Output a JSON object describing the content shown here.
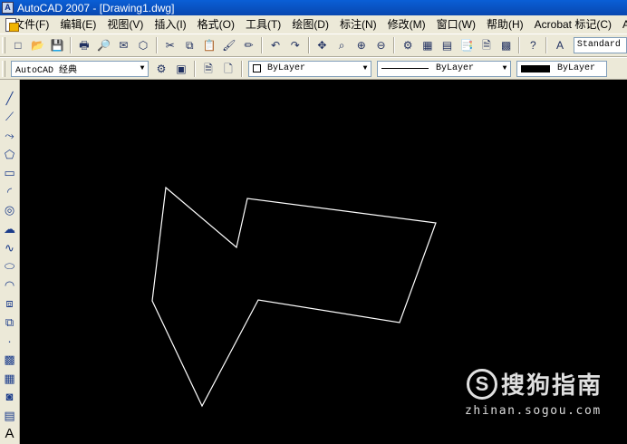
{
  "window": {
    "title": "AutoCAD 2007 - [Drawing1.dwg]",
    "app_icon_text": "A"
  },
  "menu": {
    "items": [
      "文件(F)",
      "编辑(E)",
      "视图(V)",
      "插入(I)",
      "格式(O)",
      "工具(T)",
      "绘图(D)",
      "标注(N)",
      "修改(M)",
      "窗口(W)",
      "帮助(H)",
      "Acrobat 标记(C)",
      "A"
    ]
  },
  "toolbar_standard": {
    "icons": [
      "new-icon",
      "open-icon",
      "save-icon",
      "plot-icon",
      "plot-preview-icon",
      "publish-icon",
      "3d-dwf-icon",
      "cut-icon",
      "copy-icon",
      "paste-icon",
      "match-properties-icon",
      "brush-icon",
      "undo-icon",
      "redo-icon",
      "pan-icon",
      "zoom-realtime-icon",
      "zoom-window-icon",
      "zoom-previous-icon",
      "properties-icon",
      "design-center-icon",
      "tool-palettes-icon",
      "sheet-set-icon",
      "markup-icon",
      "calculator-icon",
      "help-icon",
      "text-style-icon"
    ],
    "glyphs": [
      "□",
      "📂",
      "💾",
      "🖶",
      "🔎",
      "✉",
      "⬡",
      "✂",
      "⧉",
      "📋",
      "🖌",
      "✏",
      "↶",
      "↷",
      "✥",
      "⌕",
      "⊕",
      "⊖",
      "⚙",
      "▦",
      "▤",
      "📑",
      "🗎",
      "▩",
      "?",
      "A"
    ],
    "text_style_value": "Standard"
  },
  "toolbar_workspace": {
    "workspace_value": "AutoCAD 经典",
    "color_value": "ByLayer",
    "linetype_value": "ByLayer",
    "lineweight_value": "ByLayer",
    "icons": [
      "workspace-settings-icon",
      "workspace-toolbar-icon",
      "pdf-icon",
      "pdf-settings-icon"
    ],
    "glyphs": [
      "⚙",
      "▣",
      "🗎",
      "🗋"
    ]
  },
  "draw_toolbar": {
    "icons": [
      "line-icon",
      "construction-line-icon",
      "polyline-icon",
      "polygon-icon",
      "rectangle-icon",
      "arc-icon",
      "circle-icon",
      "revision-cloud-icon",
      "spline-icon",
      "ellipse-icon",
      "ellipse-arc-icon",
      "insert-block-icon",
      "make-block-icon",
      "point-icon",
      "hatch-icon",
      "gradient-icon",
      "region-icon",
      "table-icon",
      "multiline-text-icon"
    ],
    "glyphs": [
      "╱",
      "⟋",
      "⤳",
      "⬠",
      "▭",
      "◜",
      "◎",
      "☁",
      "∿",
      "⬭",
      "◠",
      "⧈",
      "⧉",
      "·",
      "▩",
      "▦",
      "◙",
      "▤",
      "A"
    ]
  },
  "drawing": {
    "shape": "closed-polyline",
    "stroke": "#ffffff",
    "background": "#000000"
  },
  "watermark": {
    "logo_letter": "S",
    "logo_text": "搜狗指南",
    "url": "zhinan.sogou.com"
  }
}
